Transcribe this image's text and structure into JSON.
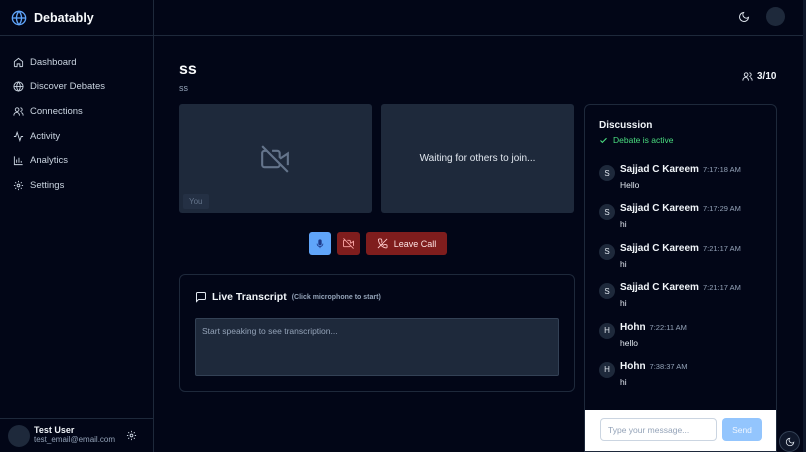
{
  "app": {
    "name": "Debatably"
  },
  "sidebar": {
    "items": [
      {
        "label": "Dashboard",
        "icon": "home-icon"
      },
      {
        "label": "Discover Debates",
        "icon": "globe-icon"
      },
      {
        "label": "Connections",
        "icon": "users-icon"
      },
      {
        "label": "Activity",
        "icon": "activity-icon"
      },
      {
        "label": "Analytics",
        "icon": "bar-chart-icon"
      },
      {
        "label": "Settings",
        "icon": "gear-icon"
      }
    ],
    "user": {
      "name": "Test User",
      "email": "test_email@email.com"
    }
  },
  "debate": {
    "title": "ss",
    "subtitle": "ss",
    "participants": "3/10"
  },
  "video": {
    "you_label": "You",
    "waiting_text": "Waiting for others to join..."
  },
  "controls": {
    "leave_label": "Leave Call"
  },
  "transcript": {
    "title": "Live Transcript",
    "hint": "(Click microphone to start)",
    "placeholder": "Start speaking to see transcription..."
  },
  "discussion": {
    "title": "Discussion",
    "status": "Debate is active",
    "messages": [
      {
        "initial": "S",
        "name": "Sajjad C Kareem",
        "time": "7:17:18 AM",
        "text": "Hello"
      },
      {
        "initial": "S",
        "name": "Sajjad C Kareem",
        "time": "7:17:29 AM",
        "text": "hi"
      },
      {
        "initial": "S",
        "name": "Sajjad C Kareem",
        "time": "7:21:17 AM",
        "text": "hi"
      },
      {
        "initial": "S",
        "name": "Sajjad C Kareem",
        "time": "7:21:17 AM",
        "text": "hi"
      },
      {
        "initial": "H",
        "name": "Hohn",
        "time": "7:22:11 AM",
        "text": "hello"
      },
      {
        "initial": "H",
        "name": "Hohn",
        "time": "7:38:37 AM",
        "text": "hi"
      }
    ],
    "input_placeholder": "Type your message...",
    "send_label": "Send"
  },
  "colors": {
    "background": "#020617",
    "panel": "#1e293b",
    "accent": "#60a5fa",
    "danger": "#7f1d1d",
    "success": "#4ade80"
  }
}
